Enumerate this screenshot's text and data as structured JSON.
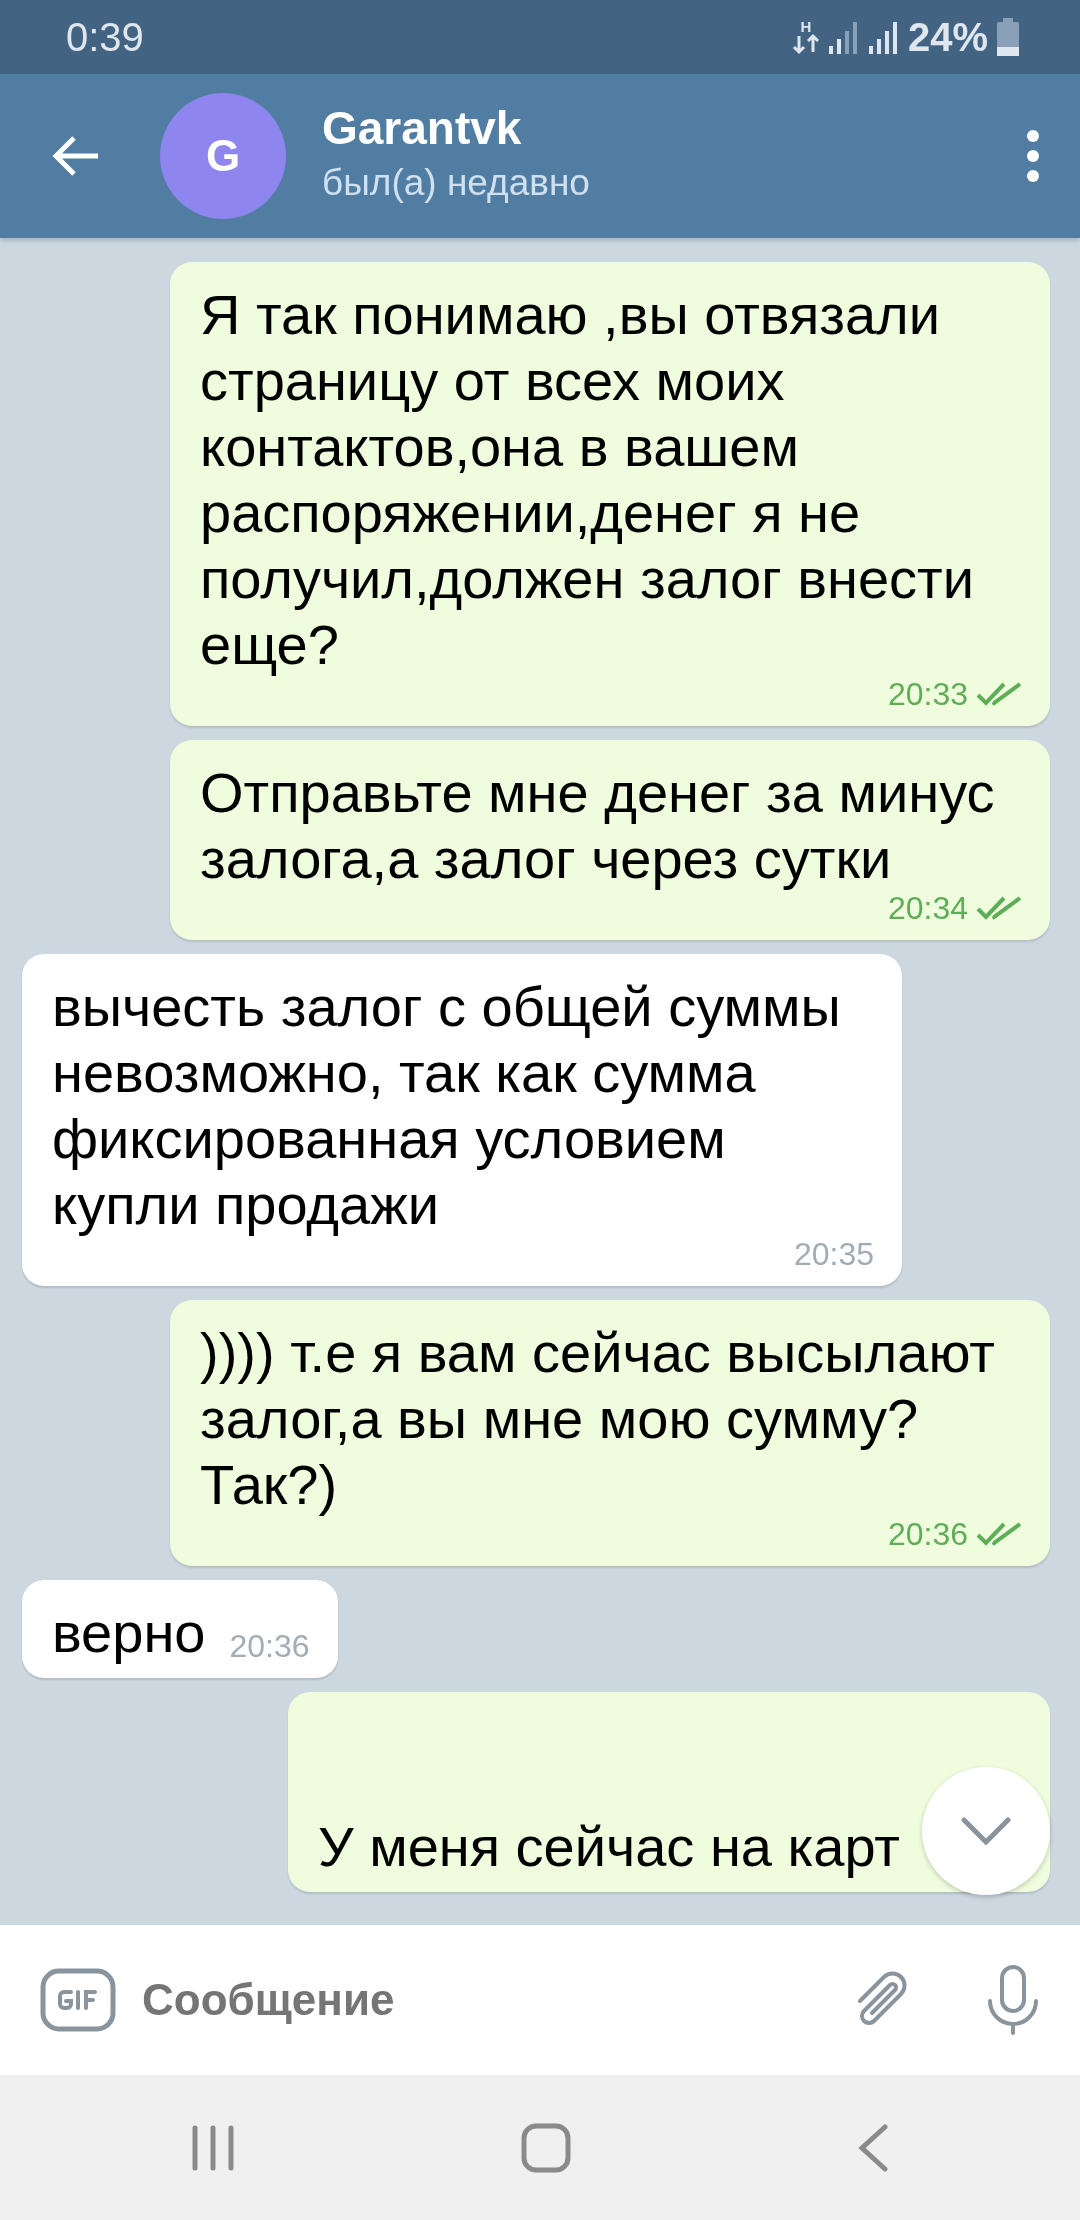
{
  "status_bar": {
    "time": "0:39",
    "network": "H",
    "battery": "24%"
  },
  "header": {
    "avatar_letter": "G",
    "name": "Garantvk",
    "status": "был(а) недавно"
  },
  "messages": [
    {
      "kind": "outgoing",
      "text": "Я так понимаю ,вы отвязали страницу от всех моих контактов,она в вашем распоряжении,денег я не получил,должен залог внести еще?",
      "time": "20:33",
      "read": true
    },
    {
      "kind": "outgoing",
      "text": "Отправьте мне денег за минус залога,а залог через сутки",
      "time": "20:34",
      "read": true
    },
    {
      "kind": "incoming",
      "text": "вычесть залог с общей суммы невозможно, так как сумма фиксированная условием купли продажи",
      "time": "20:35"
    },
    {
      "kind": "outgoing",
      "text": ")))) т.е я вам сейчас высылают залог,а вы мне мою сумму? Так?)",
      "time": "20:36",
      "read": true
    },
    {
      "kind": "incoming",
      "text": "верно",
      "time": "20:36"
    },
    {
      "kind": "outgoing",
      "text": "У меня сейчас на карт"
    }
  ],
  "composer": {
    "placeholder": "Сообщение"
  }
}
